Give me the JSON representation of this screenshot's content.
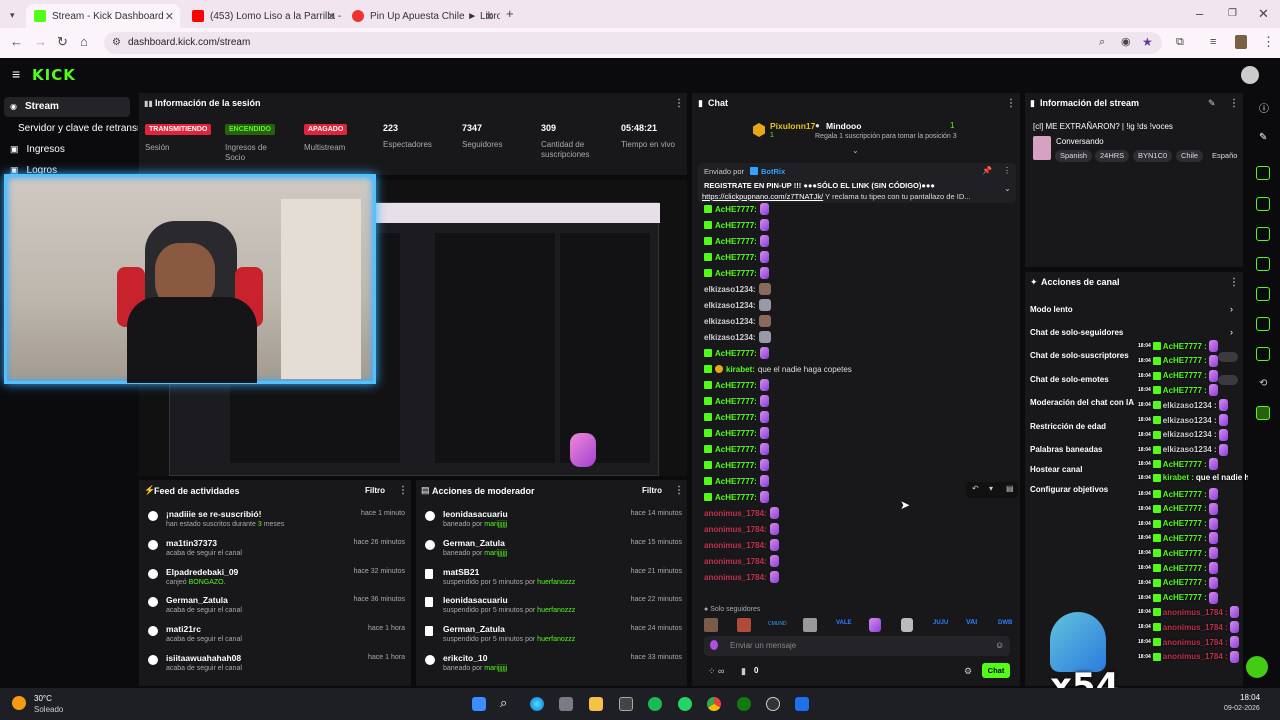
{
  "browser": {
    "tabs": [
      {
        "title": "Stream - Kick Dashboard",
        "active": true
      },
      {
        "title": "(453) Lomo Liso a la Parrilla - Y",
        "active": false
      },
      {
        "title": "Pin Up Apuesta Chile ► Libro C",
        "active": false
      }
    ],
    "url": "dashboard.kick.com/stream"
  },
  "nav": {
    "logo": "KICK",
    "items": [
      {
        "label": "Stream"
      },
      {
        "label": "Servidor y clave de retransm"
      },
      {
        "label": "Ingresos"
      },
      {
        "label": "Logros"
      }
    ]
  },
  "session": {
    "title": "Información de la sesión",
    "stats": [
      {
        "badge": "TRANSMITIENDO",
        "label": "Sesión"
      },
      {
        "badge": "ENCENDIDO",
        "label": "Ingresos de Socio"
      },
      {
        "badge": "APAGADO",
        "label": "Multistream"
      },
      {
        "value": "223",
        "label": "Espectadores"
      },
      {
        "value": "7347",
        "label": "Seguidores"
      },
      {
        "value": "309",
        "label": "Cantidad de suscripciones"
      },
      {
        "value": "05:48:21",
        "label": "Tiempo en vivo"
      }
    ]
  },
  "activity": {
    "title": "Feed de actividades",
    "filter": "Filtro",
    "rows": [
      {
        "name": "¡nadiiie se re-suscribió!",
        "sub_pre": "han estado suscritos durante ",
        "sub_hl": "3",
        "sub_post": " meses",
        "time": "hace 1 minuto"
      },
      {
        "name": "ma1tin37373",
        "sub_pre": "acaba de seguir el canal",
        "sub_hl": "",
        "sub_post": "",
        "time": "hace 26 minutos"
      },
      {
        "name": "Elpadredebaki_09",
        "sub_pre": "canjeó ",
        "sub_hl": "BONGAZO.",
        "sub_post": "",
        "time": "hace 32 minutos"
      },
      {
        "name": "German_Zatula",
        "sub_pre": "acaba de seguir el canal",
        "sub_hl": "",
        "sub_post": "",
        "time": "hace 36 minutos"
      },
      {
        "name": "mati21rc",
        "sub_pre": "acaba de seguir el canal",
        "sub_hl": "",
        "sub_post": "",
        "time": "hace 1 hora"
      },
      {
        "name": "isiitaawuahahah08",
        "sub_pre": "acaba de seguir el canal",
        "sub_hl": "",
        "sub_post": "",
        "time": "hace 1 hora"
      }
    ]
  },
  "moderator": {
    "title": "Acciones de moderador",
    "filter": "Filtro",
    "rows": [
      {
        "name": "leonidasacuariu",
        "sub_pre": "baneado por ",
        "sub_hl": "marijjjjjj",
        "time": "hace 14 minutos"
      },
      {
        "name": "German_Zatula",
        "sub_pre": "baneado por ",
        "sub_hl": "marijjjjjj",
        "time": "hace 15 minutos"
      },
      {
        "name": "matSB21",
        "sub_pre": "suspendido por 5 minutos por ",
        "sub_hl": "huerfanozzz",
        "time": "hace 21 minutos"
      },
      {
        "name": "leonidasacuariu",
        "sub_pre": "suspendido por 5 minutos por ",
        "sub_hl": "huerfanozzz",
        "time": "hace 22 minutos"
      },
      {
        "name": "German_Zatula",
        "sub_pre": "suspendido por 5 minutos por ",
        "sub_hl": "huerfanozzz",
        "time": "hace 24 minutos"
      },
      {
        "name": "erikcito_10",
        "sub_pre": "baneado por ",
        "sub_hl": "marijjjjjj",
        "time": "hace 33 minutos"
      }
    ]
  },
  "chat": {
    "title": "Chat",
    "pinned_top": {
      "user": "Pixulonn17",
      "count": "1",
      "target": "Mindooo",
      "target_count": "1",
      "text": "Regala 1 suscripción para tomar la posición 3"
    },
    "pinned": {
      "sent_by_label": "Enviado por",
      "sent_by": "BotRix",
      "line1": "REGISTRATE EN PIN-UP",
      "line1b": "!!! ●●●SÓLO EL LINK (SIN CÓDIGO)●●●",
      "link": "https://clickpupnano.com/z7TNATJk/",
      "line2": " Y reclama tu tipeo con tu pantallazo de ID..."
    },
    "messages": [
      {
        "user": "AcHE7777:",
        "color": "g"
      },
      {
        "user": "AcHE7777:",
        "color": "g"
      },
      {
        "user": "AcHE7777:",
        "color": "g"
      },
      {
        "user": "AcHE7777:",
        "color": "g"
      },
      {
        "user": "AcHE7777:",
        "color": "g"
      },
      {
        "user": "elkizaso1234:",
        "color": "w"
      },
      {
        "user": "elkizaso1234:",
        "color": "w"
      },
      {
        "user": "elkizaso1234:",
        "color": "w"
      },
      {
        "user": "elkizaso1234:",
        "color": "w"
      },
      {
        "user": "AcHE7777:",
        "color": "g"
      },
      {
        "user": "kirabet:",
        "color": "o",
        "text": "que el nadie haga copetes"
      },
      {
        "user": "AcHE7777:",
        "color": "g"
      },
      {
        "user": "AcHE7777:",
        "color": "g"
      },
      {
        "user": "AcHE7777:",
        "color": "g"
      },
      {
        "user": "AcHE7777:",
        "color": "g"
      },
      {
        "user": "AcHE7777:",
        "color": "g"
      },
      {
        "user": "AcHE7777:",
        "color": "g"
      },
      {
        "user": "AcHE7777:",
        "color": "g"
      },
      {
        "user": "AcHE7777:",
        "color": "g"
      },
      {
        "user": "anonimus_1784:",
        "color": "r"
      },
      {
        "user": "anonimus_1784:",
        "color": "r"
      },
      {
        "user": "anonimus_1784:",
        "color": "r"
      },
      {
        "user": "anonimus_1784:",
        "color": "r"
      },
      {
        "user": "anonimus_1784:",
        "color": "r"
      }
    ],
    "followers_only": "Solo seguidores",
    "emote_labels": [
      "VALE",
      "VAI",
      "DWB"
    ],
    "input_placeholder": "Enviar un mensaje",
    "count": "0",
    "send_label": "Chat"
  },
  "stream_info": {
    "title": "Información del stream",
    "stream_title": "[cl] ME EXTRAÑARON? | !ig !ds !voces",
    "category": "Conversando",
    "tags": [
      "Spanish",
      "24HRS",
      "BYN1C0",
      "Chile",
      "Españo"
    ]
  },
  "channel_actions": {
    "title": "Acciones de canal",
    "items": [
      "Modo lento",
      "Chat de solo-seguidores",
      "Chat de solo-suscriptores",
      "Chat de solo-emotes",
      "Moderación del chat con IA",
      "Restricción de edad",
      "Palabras baneadas",
      "Hostear canal",
      "Configurar objetivos"
    ]
  },
  "overlay_chat": [
    {
      "time": "18:04",
      "user": "AcHE7777 :",
      "color": "g"
    },
    {
      "time": "18:04",
      "user": "AcHE7777 :",
      "color": "g"
    },
    {
      "time": "18:04",
      "user": "AcHE7777 :",
      "color": "g"
    },
    {
      "time": "18:04",
      "user": "AcHE7777 :",
      "color": "g"
    },
    {
      "time": "18:04",
      "user": "elkizaso1234 :",
      "color": "w"
    },
    {
      "time": "18:04",
      "user": "elkizaso1234 :",
      "color": "w"
    },
    {
      "time": "18:04",
      "user": "elkizaso1234 :",
      "color": "w"
    },
    {
      "time": "18:04",
      "user": "elkizaso1234 :",
      "color": "w"
    },
    {
      "time": "18:04",
      "user": "AcHE7777 :",
      "color": "g"
    },
    {
      "time": "18:04",
      "user": "kirabet :",
      "color": "o",
      "text": " que el nadie haga copetes"
    },
    {
      "time": "18:04",
      "user": "AcHE7777 :",
      "color": "g"
    },
    {
      "time": "18:04",
      "user": "AcHE7777 :",
      "color": "g"
    },
    {
      "time": "18:04",
      "user": "AcHE7777 :",
      "color": "g"
    },
    {
      "time": "18:04",
      "user": "AcHE7777 :",
      "color": "g"
    },
    {
      "time": "18:04",
      "user": "AcHE7777 :",
      "color": "g"
    },
    {
      "time": "18:04",
      "user": "AcHE7777 :",
      "color": "g"
    },
    {
      "time": "18:04",
      "user": "AcHE7777 :",
      "color": "g"
    },
    {
      "time": "18:04",
      "user": "AcHE7777 :",
      "color": "g"
    },
    {
      "time": "18:04",
      "user": "anonimus_1784 :",
      "color": "r"
    },
    {
      "time": "18:04",
      "user": "anonimus_1784 :",
      "color": "r"
    },
    {
      "time": "18:04",
      "user": "anonimus_1784 :",
      "color": "r"
    },
    {
      "time": "18:04",
      "user": "anonimus_1784 :",
      "color": "r"
    }
  ],
  "x54": "x54",
  "taskbar": {
    "temp": "30°C",
    "weather": "Soleado",
    "time": "18:04",
    "date": "09-02-2026"
  },
  "colors": {
    "kick_green": "#53fc18",
    "live_red": "#e0243b",
    "panel": "#18181b"
  }
}
